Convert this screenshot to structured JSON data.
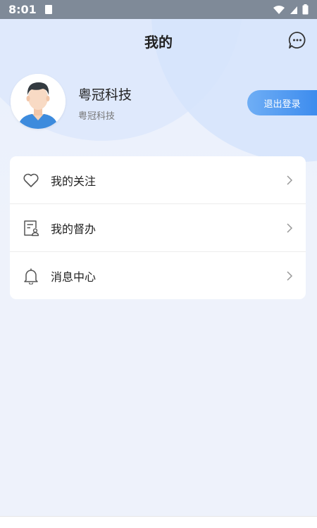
{
  "status_bar": {
    "time": "8:01"
  },
  "header": {
    "title": "我的",
    "message_icon": "chat-bubble-icon"
  },
  "profile": {
    "name": "粤冠科技",
    "org": "粤冠科技",
    "avatar_icon": "avatar-icon"
  },
  "logout": {
    "label": "退出登录"
  },
  "menu": {
    "items": [
      {
        "label": "我的关注",
        "icon": "heart-icon"
      },
      {
        "label": "我的督办",
        "icon": "document-user-icon"
      },
      {
        "label": "消息中心",
        "icon": "bell-icon"
      }
    ]
  },
  "colors": {
    "accent": "#3d8cee",
    "accent_light": "#6faef5",
    "status_bar": "#7f8a98",
    "background": "#eef2fb",
    "text_primary": "#222222",
    "text_secondary": "#777777"
  }
}
